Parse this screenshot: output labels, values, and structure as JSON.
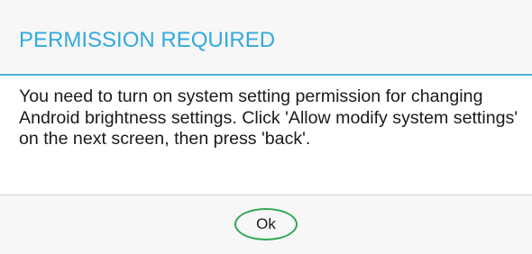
{
  "dialog": {
    "title": "PERMISSION REQUIRED",
    "message": "You need to turn on system setting permission for changing Android brightness settings. Click 'Allow modify system settings' on the next screen, then press 'back'.",
    "ok_label": "Ok"
  },
  "colors": {
    "title": "#33a9dd",
    "divider_accent": "#4ab3e2",
    "ok_highlight": "#2fa84f",
    "background": "#f7f7f7"
  }
}
